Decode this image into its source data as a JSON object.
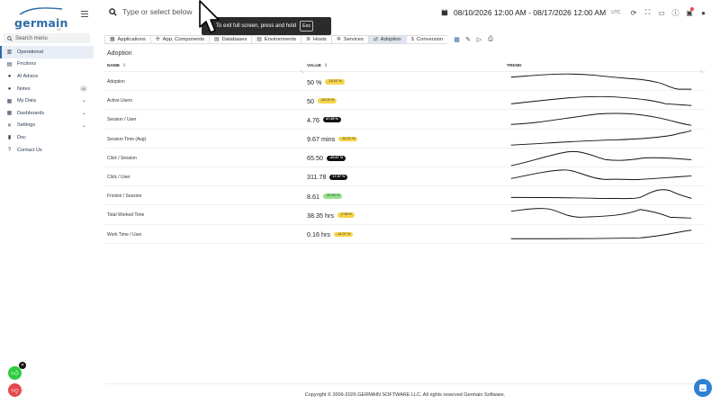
{
  "brand": {
    "name": "germain",
    "sub": "UX",
    "accent": "#2f6aa7"
  },
  "sidebar": {
    "search_placeholder": "Search menu",
    "items": [
      {
        "label": "Operational",
        "icon": "chart-icon",
        "active": true
      },
      {
        "label": "Frictions",
        "icon": "friction-icon"
      },
      {
        "label": "AI Advice",
        "icon": "ai-icon"
      },
      {
        "label": "Notes",
        "icon": "notes-icon",
        "badge": "40"
      },
      {
        "label": "My Data",
        "icon": "data-icon",
        "expandable": true
      },
      {
        "label": "Dashboards",
        "icon": "dashboard-icon",
        "expandable": true
      },
      {
        "label": "Settings",
        "icon": "settings-icon",
        "expandable": true
      },
      {
        "label": "Doc",
        "icon": "book-icon"
      },
      {
        "label": "Contact Us",
        "icon": "help-icon"
      }
    ]
  },
  "topbar": {
    "search_placeholder": "Type or select below",
    "fullscreen_toast": "To exit full screen, press and hold",
    "fullscreen_key": "Esc",
    "date_range": "08/10/2026 12:00 AM - 08/17/2026 12:00 AM",
    "timezone": "UTC",
    "icons": [
      "refresh-icon",
      "fullscreen-icon",
      "monitor-icon",
      "info-icon",
      "notifications-icon",
      "user-icon"
    ]
  },
  "tabs": [
    {
      "label": "Applications",
      "icon": "apps-icon"
    },
    {
      "label": "App. Components",
      "icon": "components-icon"
    },
    {
      "label": "Databases",
      "icon": "database-icon"
    },
    {
      "label": "Environments",
      "icon": "environment-icon"
    },
    {
      "label": "Hosts",
      "icon": "hosts-icon"
    },
    {
      "label": "Services",
      "icon": "services-icon"
    },
    {
      "label": "Adoption",
      "icon": "adoption-icon",
      "active": true
    },
    {
      "label": "Conversion",
      "icon": "conversion-icon"
    }
  ],
  "tab_tools": [
    "calendar-icon",
    "edit-icon",
    "play-icon",
    "print-icon"
  ],
  "main": {
    "section_title": "Adoption",
    "columns": {
      "name": "NAME",
      "value": "VALUE",
      "trend": "TREND"
    },
    "rows": [
      {
        "name": "Adoption",
        "value": "50 %",
        "change": "-16.03 %",
        "tone": "yellow"
      },
      {
        "name": "Active Users",
        "value": "50",
        "change": "-16.03 %",
        "tone": "yellow"
      },
      {
        "name": "Session / User",
        "value": "4.76",
        "change": "47.39 %",
        "tone": "dark"
      },
      {
        "name": "Session Time (Avg)",
        "value": "9.67 mins",
        "change": "-16.21 %",
        "tone": "yellow"
      },
      {
        "name": "Click / Session",
        "value": "65.50",
        "change": "-20.67 %",
        "tone": "dark"
      },
      {
        "name": "Click / User",
        "value": "311.78",
        "change": "17.07 %",
        "tone": "dark"
      },
      {
        "name": "Friction / Session",
        "value": "8.61",
        "change": "-20.26 %",
        "tone": "green"
      },
      {
        "name": "Total Worked Time",
        "value": "38.35 hrs",
        "change": "-2.38 %",
        "tone": "yellow"
      },
      {
        "name": "Work Time / User",
        "value": "0.16 hrs",
        "change": "-14.21 %",
        "tone": "yellow"
      }
    ]
  },
  "footer": "Copyright © 2006-2026 GERMAIN SOFTWARE LLC. All rights reserved Germain Software."
}
